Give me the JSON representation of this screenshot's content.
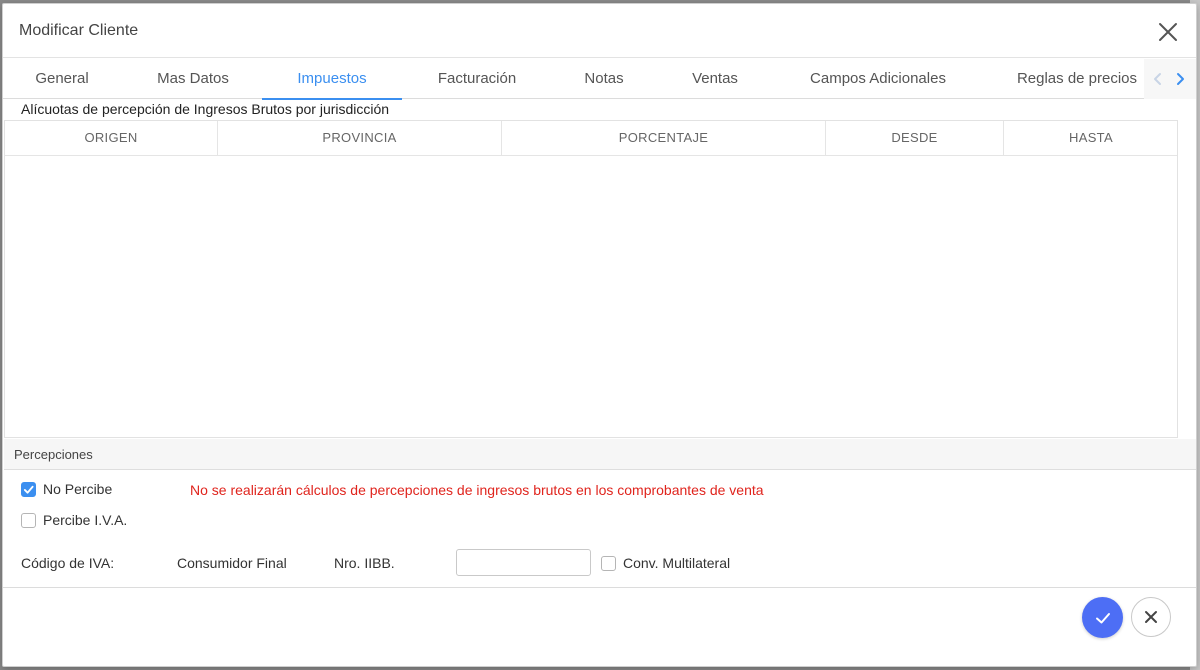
{
  "dialog": {
    "title": "Modificar Cliente"
  },
  "tabs": [
    {
      "label": "General",
      "active": false
    },
    {
      "label": "Mas Datos",
      "active": false
    },
    {
      "label": "Impuestos",
      "active": true
    },
    {
      "label": "Facturación",
      "active": false
    },
    {
      "label": "Notas",
      "active": false
    },
    {
      "label": "Ventas",
      "active": false
    },
    {
      "label": "Campos Adicionales",
      "active": false
    },
    {
      "label": "Reglas de precios",
      "active": false
    }
  ],
  "alicuotas": {
    "caption": "Alícuotas de percepción de Ingresos Brutos por jurisdicción",
    "columns": [
      "ORIGEN",
      "PROVINCIA",
      "PORCENTAJE",
      "DESDE",
      "HASTA"
    ],
    "rows": []
  },
  "percepciones": {
    "section_label": "Percepciones",
    "no_percibe": {
      "label": "No Percibe",
      "checked": true
    },
    "percibe_iva": {
      "label": "Percibe I.V.A.",
      "checked": false
    },
    "warning": "No se realizarán cálculos de percepciones de ingresos brutos en los comprobantes de venta",
    "codigo_iva_label": "Código de IVA:",
    "codigo_iva_value": "Consumidor Final",
    "nro_iibb_label": "Nro. IIBB.",
    "nro_iibb_value": "",
    "conv_multilateral": {
      "label": "Conv. Multilateral",
      "checked": false
    }
  },
  "colors": {
    "accent": "#3b8ff0",
    "confirm": "#4d6ef5",
    "warning": "#e0241d"
  },
  "icons": {
    "close": "close-icon",
    "confirm": "check-icon",
    "cancel": "close-icon",
    "tab_prev": "chevron-left-icon",
    "tab_next": "chevron-right-icon"
  }
}
